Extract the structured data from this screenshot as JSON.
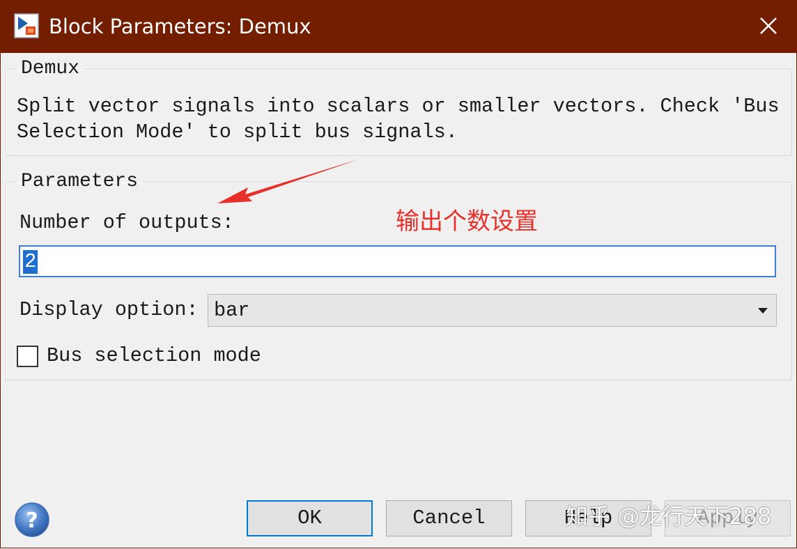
{
  "window": {
    "title": "Block Parameters: Demux"
  },
  "block_group": {
    "legend": "Demux",
    "description": "Split vector signals into scalars or smaller vectors. Check 'Bus\nSelection Mode' to split bus signals."
  },
  "params_group": {
    "legend": "Parameters",
    "num_outputs_label": "Number of outputs:",
    "num_outputs_value": "2",
    "display_option_label": "Display option:",
    "display_option_value": "bar",
    "bus_selection_label": "Bus selection mode",
    "bus_selection_checked": false
  },
  "annotation": {
    "text": "输出个数设置",
    "color": "#e8302a"
  },
  "buttons": {
    "ok": "OK",
    "cancel": "Cancel",
    "help": "Help",
    "apply": "Apply"
  },
  "watermark": {
    "text": "知乎 @龙行天下288"
  },
  "icons": {
    "app": "simulink-block-icon",
    "close": "close-icon",
    "help": "help-question-icon",
    "dropdown": "chevron-down-icon"
  },
  "colors": {
    "titlebar": "#731e00",
    "focus": "#0078d7",
    "selection": "#1f6fd1"
  }
}
